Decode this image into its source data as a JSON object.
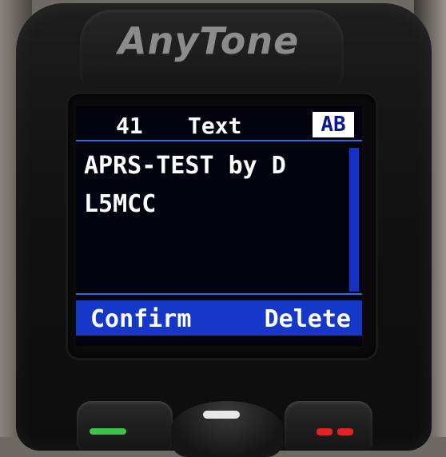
{
  "device": {
    "brand": "AnyTone"
  },
  "screen": {
    "header": {
      "number": "41",
      "title": "Text",
      "input_mode": "AB"
    },
    "message_lines": [
      "APRS-TEST by D",
      "L5MCC"
    ],
    "softkeys": {
      "left": "Confirm",
      "right": "Delete"
    }
  },
  "colors": {
    "accent": "#1538c8",
    "screen_bg": "#02030f",
    "divider": "#2c6fe0"
  }
}
